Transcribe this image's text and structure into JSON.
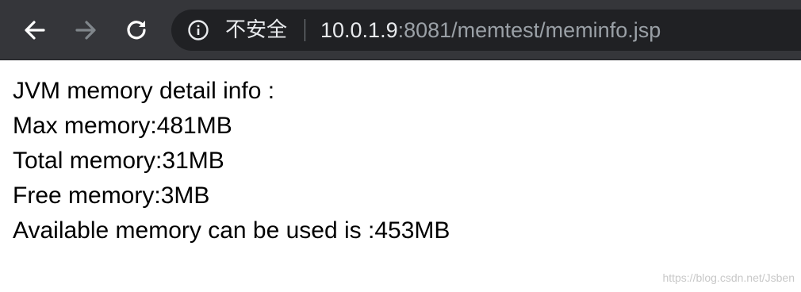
{
  "browser": {
    "security_label": "不安全",
    "url_host": "10.0.1.9",
    "url_rest": ":8081/memtest/meminfo.jsp"
  },
  "page": {
    "heading": "JVM memory detail info :",
    "lines": [
      "Max memory:481MB",
      "Total memory:31MB",
      "Free memory:3MB",
      "Available memory can be used is :453MB"
    ]
  },
  "watermark": "https://blog.csdn.net/Jsben",
  "colors": {
    "toolbar_bg": "#35363a",
    "omnibox_bg": "#202124",
    "icon_active": "#ffffff",
    "icon_disabled": "#80868b"
  },
  "icons": {
    "back": "arrow-left",
    "forward": "arrow-right",
    "reload": "reload",
    "info": "info-circle"
  }
}
